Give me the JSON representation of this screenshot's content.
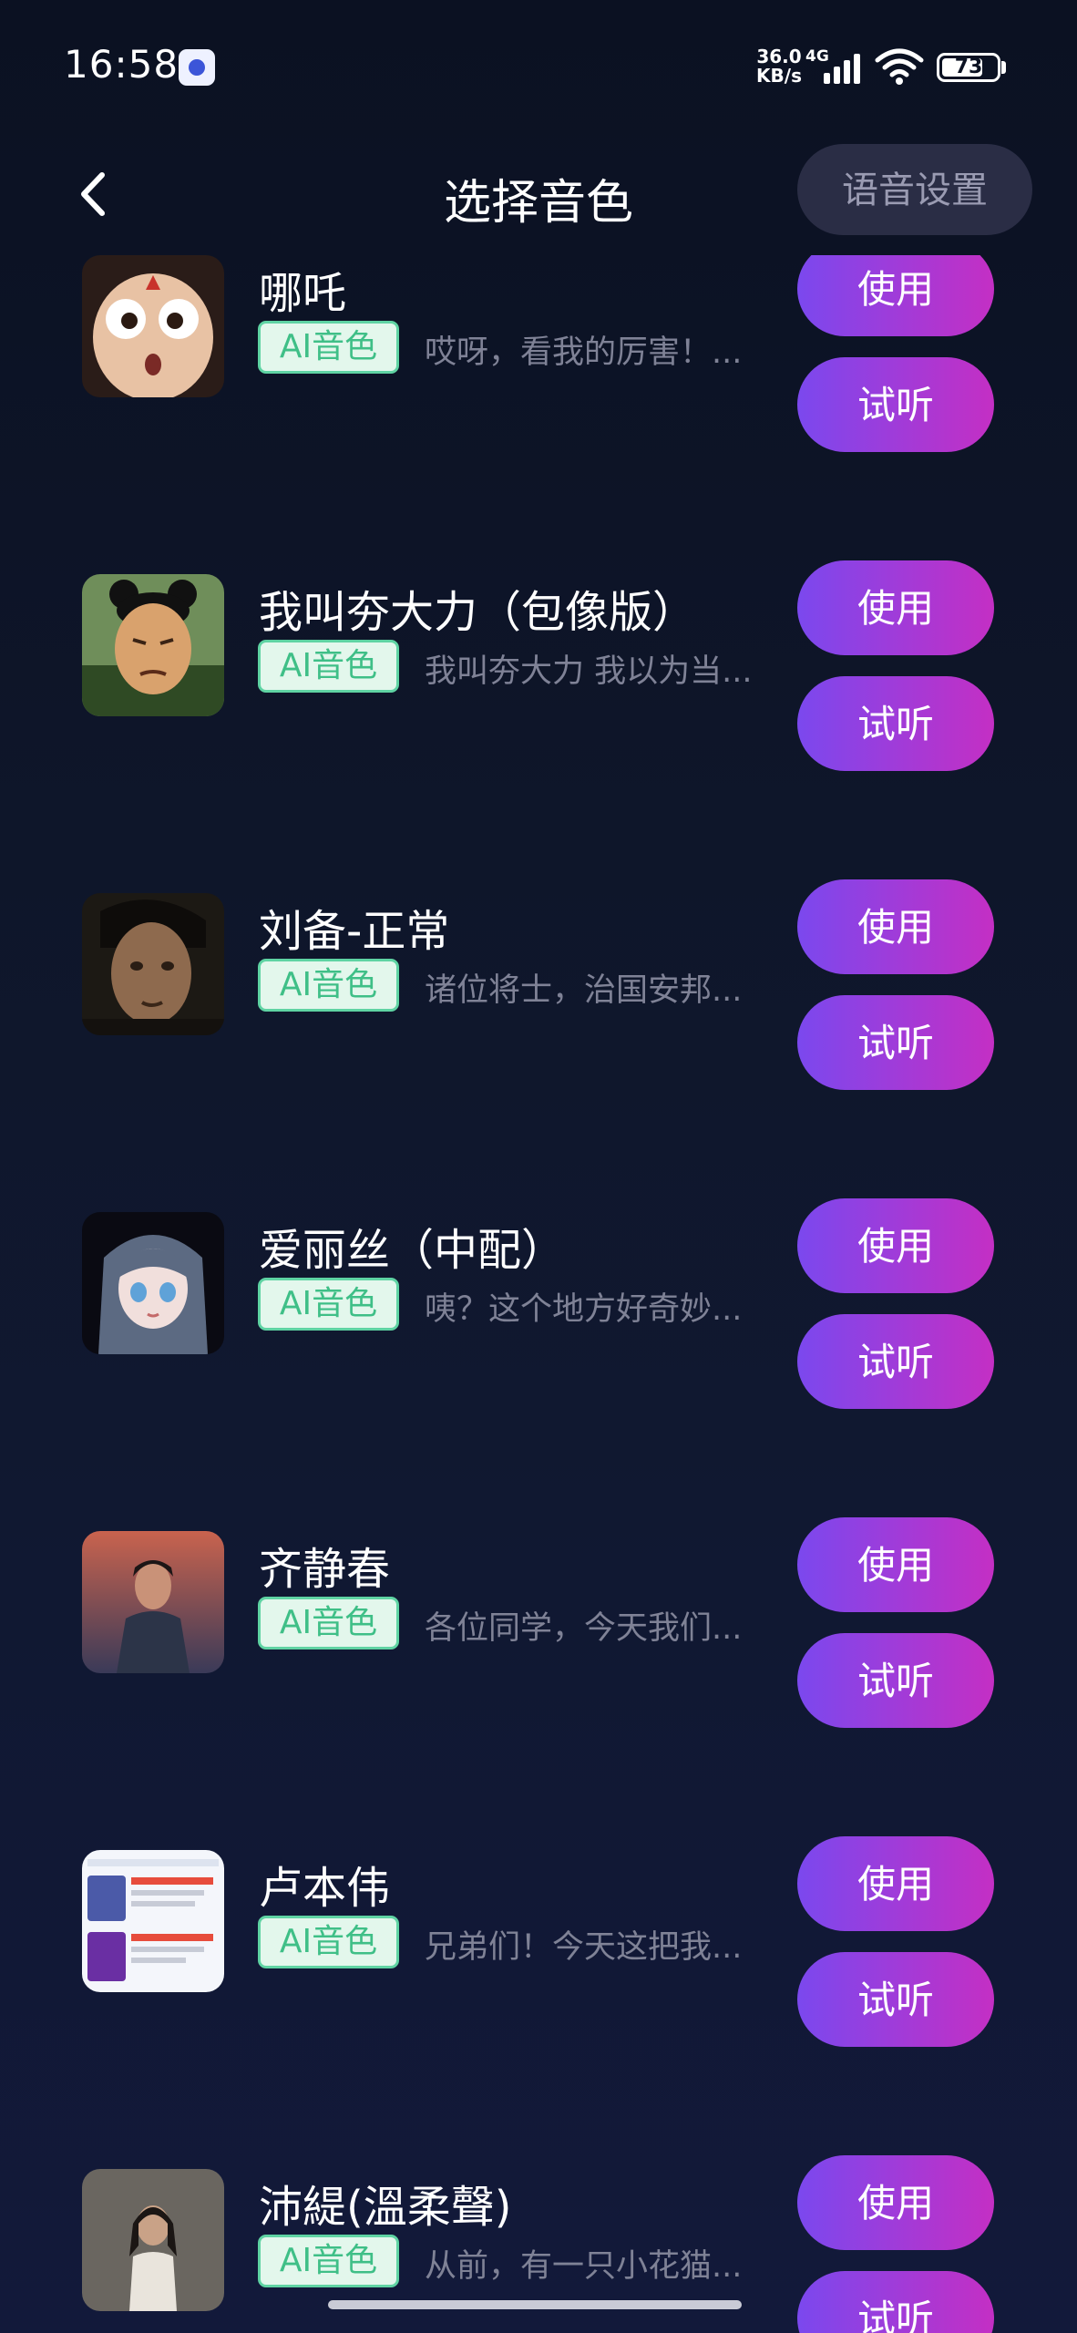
{
  "status_bar": {
    "time": "16:58",
    "net_speed": "36.0 KB/s",
    "network_type": "4G",
    "battery": "73"
  },
  "header": {
    "title": "选择音色",
    "settings_label": "语音设置"
  },
  "buttons": {
    "use_label": "使用",
    "listen_label": "试听"
  },
  "tag_label": "AI音色",
  "voices": [
    {
      "name": "哪吒",
      "desc": "哎呀，看我的厉害！..."
    },
    {
      "name": "我叫夯大力（包像版）",
      "desc": "我叫夯大力 我以为当..."
    },
    {
      "name": "刘备-正常",
      "desc": "诸位将士，治国安邦..."
    },
    {
      "name": "爱丽丝（中配）",
      "desc": "咦？这个地方好奇妙..."
    },
    {
      "name": "齐静春",
      "desc": "各位同学，今天我们..."
    },
    {
      "name": "卢本伟",
      "desc": "兄弟们！今天这把我..."
    },
    {
      "name": "沛緹(溫柔聲)",
      "desc": "从前，有一只小花猫..."
    }
  ],
  "colors": {
    "background": "#0d1326",
    "button_gradient_start": "#7b48ee",
    "button_gradient_end": "#c42fc4",
    "tag_border": "#5fd3a3",
    "tag_text": "#3fbf87"
  }
}
